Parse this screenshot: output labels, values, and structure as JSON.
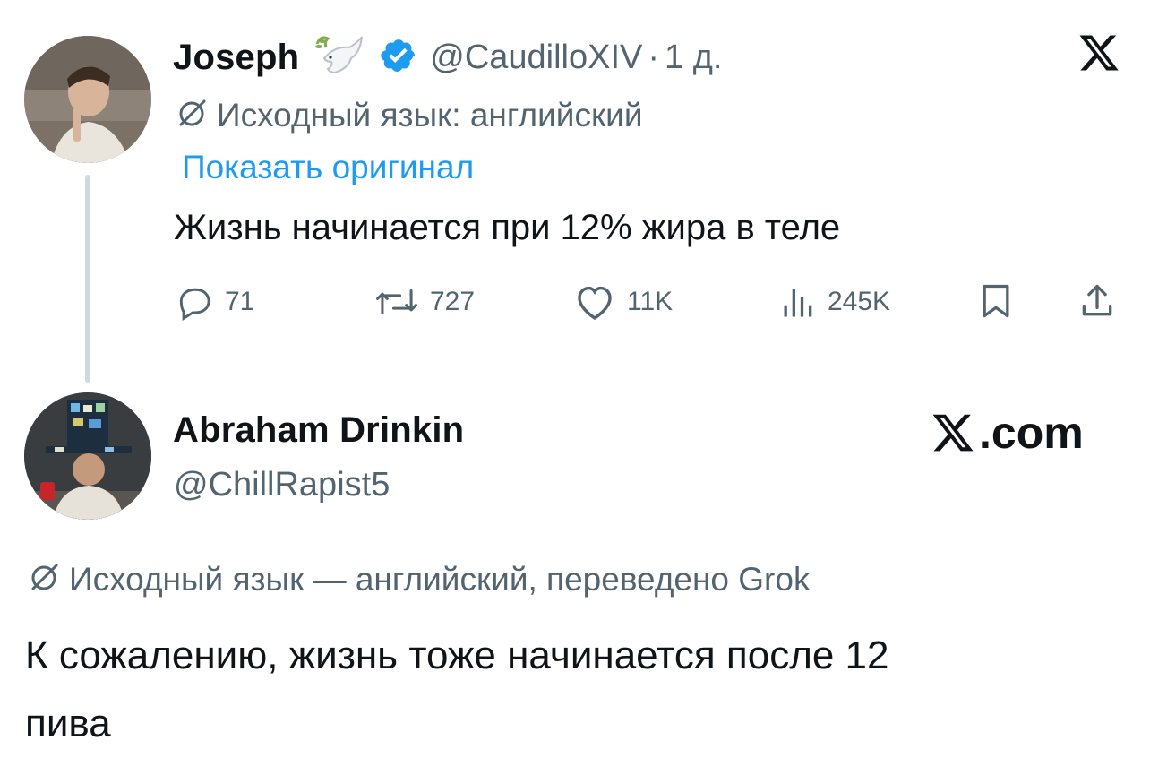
{
  "tweet": {
    "author_name": "Joseph",
    "handle": "@CaudilloXIV",
    "separator": "·",
    "time": "1 д.",
    "source_language_note": "Исходный язык: английский",
    "show_original": "Показать оригинал",
    "text": "Жизнь начинается при 12% жира в теле",
    "replies": "71",
    "reposts": "727",
    "likes": "11K",
    "views": "245K",
    "icons": {
      "name_emoji": "dove-emoji",
      "verified": "verified-badge-icon",
      "platform": "x-logo-icon",
      "translate": "translate-icon"
    }
  },
  "reply": {
    "author_name": "Abraham Drinkin",
    "handle": "@ChillRapist5",
    "brand": ".com",
    "translation_note": "Исходный язык — английский, переведено Grok",
    "text_line1": "К сожалению, жизнь тоже начинается после 12",
    "text_line2": "пива"
  },
  "colors": {
    "text": "#0f1419",
    "secondary": "#536471",
    "link": "#1d9bf0",
    "verified": "#1d9bf0",
    "thread_line": "#cfd9de"
  }
}
